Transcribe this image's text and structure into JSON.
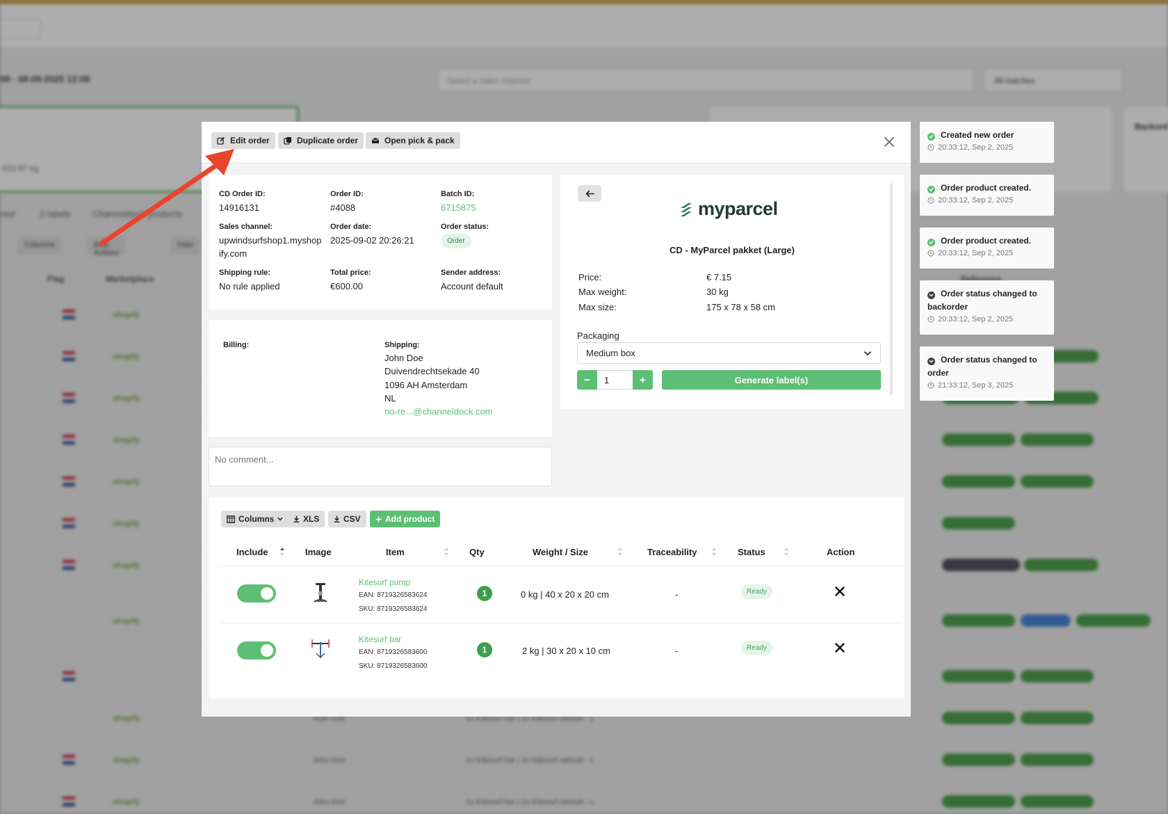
{
  "background": {
    "date_range": "08 - 08-09-2025 12:08",
    "channel_placeholder": "Select a sales channel",
    "batches_label": "All batches",
    "weight_text": "433.87 kg",
    "tabs": [
      "ned",
      "2 labels",
      "Channeldock products"
    ],
    "tools": [
      "Columns",
      "Bulk Actions",
      "Dow"
    ],
    "headers": [
      "Flag",
      "Marketplace",
      "Reference"
    ],
    "side_header": "Backord",
    "shop_name": "shopify",
    "names": [
      "Hulli Hulli",
      "John Doe",
      "John Doe"
    ],
    "items_text": "1x Kitesurf bar | 1x Kitesurf wetsuit - L"
  },
  "header": {
    "edit_label": "Edit order",
    "duplicate_label": "Duplicate order",
    "pickpack_label": "Open pick & pack",
    "close_icon": "close-icon"
  },
  "order": {
    "cd_order_id_label": "CD Order ID:",
    "cd_order_id": "14916131",
    "order_id_label": "Order ID:",
    "order_id": "#4088",
    "batch_id_label": "Batch ID:",
    "batch_id": "6715875",
    "sales_channel_label": "Sales channel:",
    "sales_channel_line1": "upwindsurfshop1.myshop",
    "sales_channel_line2": "ify.com",
    "order_date_label": "Order date:",
    "order_date": "2025-09-02 20:26:21",
    "order_status_label": "Order status:",
    "order_status": "Order",
    "shipping_rule_label": "Shipping rule:",
    "shipping_rule": "No rule applied",
    "total_price_label": "Total price:",
    "total_price": "€600.00",
    "sender_address_label": "Sender address:",
    "sender_address": "Account default"
  },
  "addresses": {
    "billing_label": "Billing:",
    "shipping_label": "Shipping:",
    "shipping_name": "John Doe",
    "shipping_street": "Duivendrechtsekade 40",
    "shipping_city": "1096 AH Amsterdam",
    "shipping_country": "NL",
    "shipping_email": "no-re...@channeldock.com"
  },
  "comment": {
    "placeholder": "No comment..."
  },
  "shipping": {
    "carrier_logo_text": "myparcel",
    "product_name": "CD - MyParcel pakket (Large)",
    "price_label": "Price:",
    "price": "€ 7.15",
    "max_weight_label": "Max weight:",
    "max_weight": "30 kg",
    "max_size_label": "Max size:",
    "max_size": "175 x 78 x 58 cm",
    "packaging_label": "Packaging",
    "packaging_value": "Medium box",
    "quantity": "1",
    "minus_label": "−",
    "plus_label": "+",
    "generate_label": "Generate label(s)"
  },
  "products": {
    "toolbar": {
      "columns_label": "Columns",
      "xls_label": "XLS",
      "csv_label": "CSV",
      "add_label": "Add product"
    },
    "headers": {
      "include": "Include",
      "image": "Image",
      "item": "Item",
      "qty": "Qty",
      "weight_size": "Weight / Size",
      "traceability": "Traceability",
      "status": "Status",
      "action": "Action"
    },
    "rows": [
      {
        "name": "Kitesurf pump",
        "ean": "EAN: 8719326583624",
        "sku": "SKU: 8719326583624",
        "qty": "1",
        "weight_size": "0 kg | 40 x 20 x 20 cm",
        "traceability": "-",
        "status": "Ready",
        "included": true
      },
      {
        "name": "Kitesurf bar",
        "ean": "EAN: 8719326583600",
        "sku": "SKU: 8719326583600",
        "qty": "1",
        "weight_size": "2 kg | 30 x 20 x 10 cm",
        "traceability": "-",
        "status": "Ready",
        "included": true
      }
    ]
  },
  "notifications": [
    {
      "title": "Created new order",
      "time": "20:33:12, Sep 2, 2025",
      "status": "success"
    },
    {
      "title": "Order product created.",
      "time": "20:33:12, Sep 2, 2025",
      "status": "success"
    },
    {
      "title": "Order product created.",
      "time": "20:33:12, Sep 2, 2025",
      "status": "success"
    },
    {
      "title": "Order status changed to backorder",
      "time": "20:33:12, Sep 2, 2025",
      "status": "neutral"
    },
    {
      "title": "Order status changed to order",
      "time": "21:33:12, Sep 3, 2025",
      "status": "neutral"
    }
  ],
  "colors": {
    "accent_green": "#5cbf73",
    "qty_badge_green": "#3e9f4a",
    "annotation_arrow": "#e8452c",
    "topbar_accent": "#d89a2a"
  }
}
